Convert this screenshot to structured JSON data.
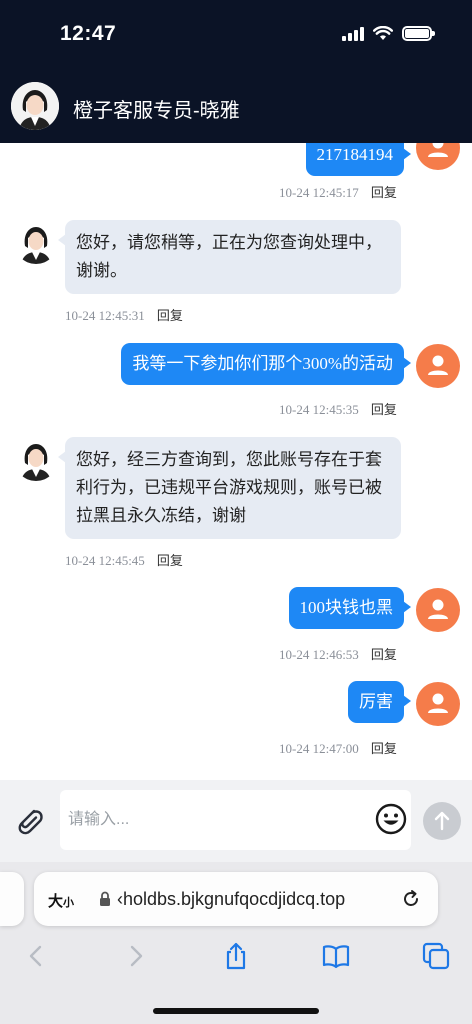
{
  "status_bar": {
    "time": "12:47"
  },
  "header": {
    "agent_name": "橙子客服专员-晓雅"
  },
  "messages": [
    {
      "side": "out",
      "text": "217184194",
      "time": "10-24 12:45:17",
      "reply": "回复"
    },
    {
      "side": "in",
      "lines": [
        "您好，请您稍等，正在为您查询处理中，",
        "谢谢。"
      ],
      "time": "10-24 12:45:31",
      "reply": "回复"
    },
    {
      "side": "out",
      "text": "我等一下参加你们那个300%的活动",
      "time": "10-24 12:45:35",
      "reply": "回复"
    },
    {
      "side": "in",
      "lines": [
        "您好，经三方查询到，您此账号存在于套",
        "利行为，已违规平台游戏规则，账号已被",
        "拉黑且永久冻结，谢谢"
      ],
      "time": "10-24 12:45:45",
      "reply": "回复"
    },
    {
      "side": "out",
      "text": "100块钱也黑",
      "time": "10-24 12:46:53",
      "reply": "回复"
    },
    {
      "side": "out",
      "text": "厉害",
      "time": "10-24 12:47:00",
      "reply": "回复"
    }
  ],
  "composer": {
    "placeholder": "请输入..."
  },
  "browser": {
    "text_size_label": "大",
    "text_size_small": "小",
    "url": "‹holdbs.bjkgnufqocdjidcq.top"
  },
  "colors": {
    "header_bg": "#0b1326",
    "user_bubble": "#1e88f5",
    "agent_bubble": "#e6ebf3",
    "user_avatar": "#f57c4a",
    "toolbar_icon": "#1e78e6"
  }
}
